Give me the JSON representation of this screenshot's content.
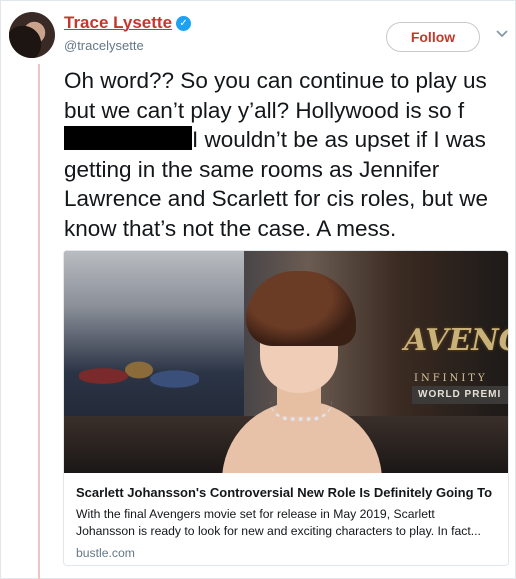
{
  "author": {
    "display_name": "Trace Lysette",
    "handle": "@tracelysette",
    "verified_glyph": "✓"
  },
  "follow_button_label": "Follow",
  "tweet": {
    "text_before_redaction": "Oh word?? So you can continue to play us but we can’t play y’all? Hollywood is so f",
    "text_after_redaction": "I wouldn’t be as upset if I was getting in the same rooms as Jennifer Lawrence and Scarlett for cis roles, but we know that’s not the case. A mess."
  },
  "link_card": {
    "image_text": {
      "logo": "AVENG",
      "subtitle": "INFINITY",
      "banner": "WORLD PREMI"
    },
    "title": "Scarlett Johansson's Controversial New Role Is Definitely Going To ...",
    "description": "With the final Avengers movie set for release in May 2019, Scarlett Johansson is ready to look for new and exciting characters to play. In fact...",
    "domain": "bustle.com"
  },
  "colors": {
    "name_red": "#c0392b",
    "verified_blue": "#1da1f2",
    "rule_pink": "#e9c7c4"
  },
  "icons": [
    "verified-badge-icon",
    "chevron-down-icon"
  ]
}
